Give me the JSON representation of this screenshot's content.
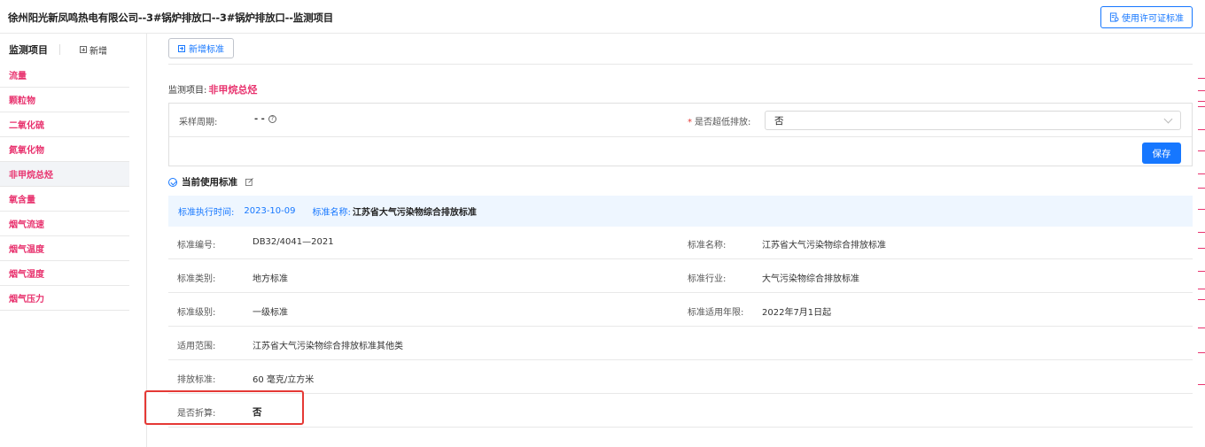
{
  "header": {
    "title": "徐州阳光新凤鸣热电有限公司--3#锅炉排放口--3#锅炉排放口--监测项目",
    "license_button": "使用许可证标准"
  },
  "sidebar": {
    "title": "监测项目",
    "add_label": "新增",
    "items": [
      {
        "label": "流量"
      },
      {
        "label": "颗粒物"
      },
      {
        "label": "二氧化硫"
      },
      {
        "label": "氮氧化物"
      },
      {
        "label": "非甲烷总烃"
      },
      {
        "label": "氧含量"
      },
      {
        "label": "烟气流速"
      },
      {
        "label": "烟气温度"
      },
      {
        "label": "烟气湿度"
      },
      {
        "label": "烟气压力"
      }
    ],
    "active_index": 4
  },
  "main": {
    "add_standard_button": "新增标准",
    "monitor_item_label": "监测项目:",
    "monitor_item_value": "非甲烷总烃",
    "form": {
      "period_label": "采样周期:",
      "period_value": "- -",
      "ultra_low_label": "是否超低排放:",
      "ultra_low_required": "*",
      "ultra_low_value": "否",
      "save_button": "保存"
    },
    "current_standard_title": "当前使用标准",
    "info_bar": {
      "exec_time_label": "标准执行时间:",
      "exec_time_value": "2023-10-09",
      "name_label": "标准名称:",
      "name_value": "江苏省大气污染物综合排放标准"
    },
    "details": {
      "code_label": "标准编号:",
      "code_value": "DB32/4041—2021",
      "name_label": "标准名称:",
      "name_value": "江苏省大气污染物综合排放标准",
      "type_label": "标准类别:",
      "type_value": "地方标准",
      "industry_label": "标准行业:",
      "industry_value": "大气污染物综合排放标准",
      "level_label": "标准级别:",
      "level_value": "一级标准",
      "years_label": "标准适用年限:",
      "years_value": "2022年7月1日起",
      "scope_label": "适用范围:",
      "scope_value": "江苏省大气污染物综合排放标准其他类",
      "emission_label": "排放标准:",
      "emission_value": "60 毫克/立方米",
      "discount_label": "是否折算:",
      "discount_value": "否"
    }
  },
  "colors": {
    "accent": "#1677ff",
    "item_pink": "#e8326e",
    "highlight_red": "#e53935",
    "info_bg": "#eef6ff"
  }
}
